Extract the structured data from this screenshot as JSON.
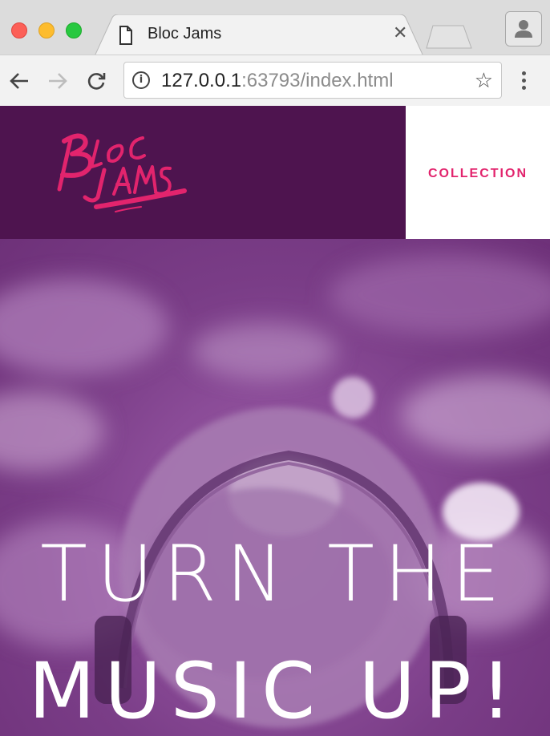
{
  "browser": {
    "tab_title": "Bloc Jams",
    "url_host": "127.0.0.1",
    "url_rest": ":63793/index.html",
    "icons": [
      "close-icon",
      "document-icon",
      "back-arrow-icon",
      "forward-arrow-icon",
      "reload-icon",
      "info-icon",
      "star-icon",
      "menu-icon",
      "profile-icon"
    ]
  },
  "site": {
    "logo_text": "Bloc Jams",
    "nav": {
      "collection_label": "COLLECTION"
    },
    "hero": {
      "line1": "TURN THE",
      "line2": "MUSIC UP!"
    }
  },
  "colors": {
    "navbar_bg": "#4e144f",
    "accent": "#e2246d",
    "hero_tint": "#8b4c98"
  }
}
